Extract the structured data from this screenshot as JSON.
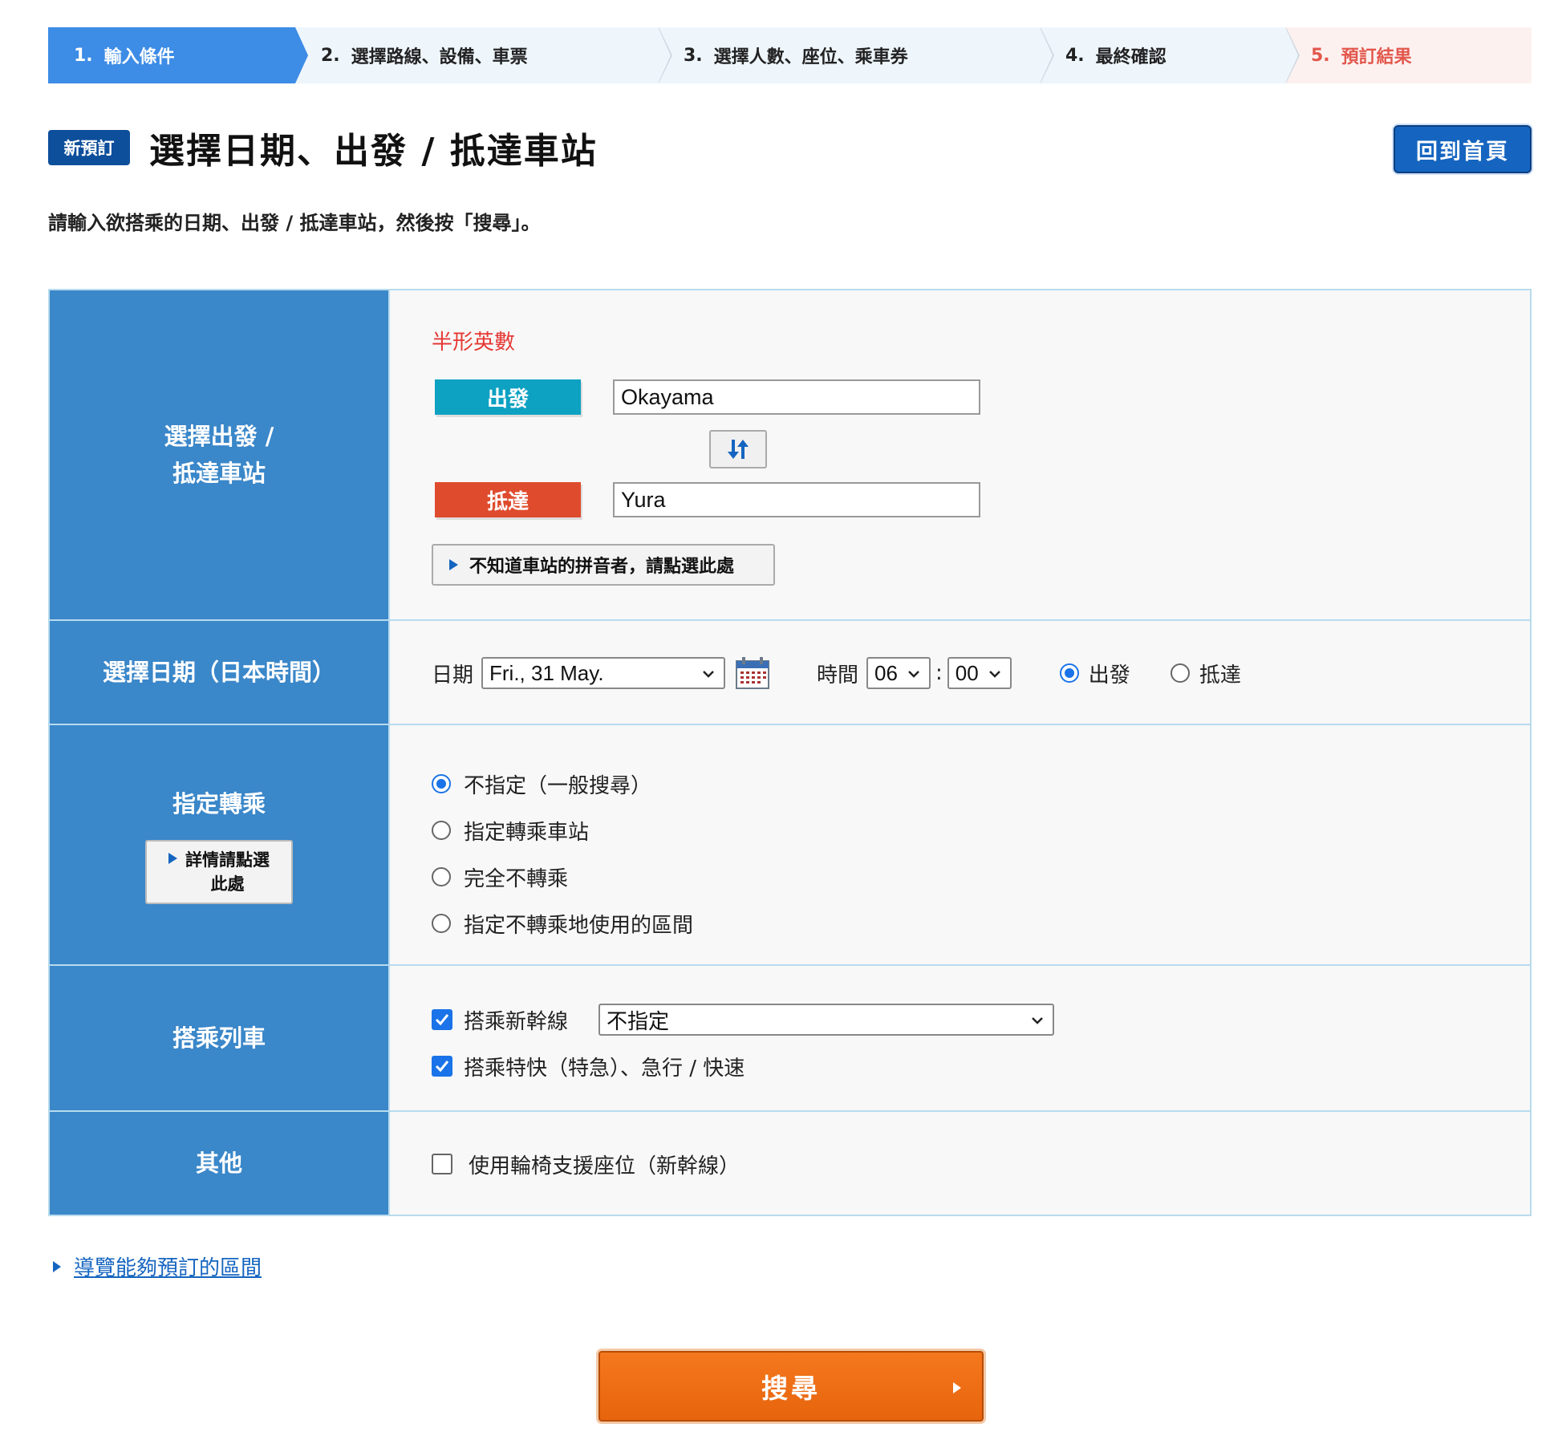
{
  "steps": [
    {
      "num": "1.",
      "label": "輸入條件"
    },
    {
      "num": "2.",
      "label": "選擇路線、設備、車票"
    },
    {
      "num": "3.",
      "label": "選擇人數、座位、乘車券"
    },
    {
      "num": "4.",
      "label": "最終確認"
    },
    {
      "num": "5.",
      "label": "預訂結果"
    }
  ],
  "header": {
    "badge": "新預訂",
    "title": "選擇日期、出發 / 抵達車站",
    "home_button": "回到首頁"
  },
  "intro": "請輸入欲搭乘的日期、出發 / 抵達車站，然後按「搜尋」。",
  "stations": {
    "label_line1": "選擇出發 /",
    "label_line2": "抵達車站",
    "hint": "半形英數",
    "departure_tag": "出發",
    "departure_value": "Okayama",
    "arrival_tag": "抵達",
    "arrival_value": "Yura",
    "pinyin_button": "不知道車站的拼音者，請點選此處"
  },
  "date": {
    "label": "選擇日期（日本時間）",
    "date_label": "日期",
    "date_value": "Fri., 31 May.",
    "time_label": "時間",
    "hour": "06",
    "colon": ":",
    "minute": "00",
    "opt_depart": "出發",
    "opt_arrive": "抵達",
    "selected": "出發"
  },
  "transfer": {
    "label": "指定轉乘",
    "detail_line1": "詳情請點選",
    "detail_line2": "此處",
    "options": [
      "不指定（一般搜尋）",
      "指定轉乘車站",
      "完全不轉乘",
      "指定不轉乘地使用的區間"
    ],
    "selected_index": 0
  },
  "trains": {
    "label": "搭乘列車",
    "shinkansen": "搭乘新幹線",
    "shinkansen_checked": true,
    "shinkansen_select": "不指定",
    "express": "搭乘特快（特急）、急行 / 快速",
    "express_checked": true
  },
  "other": {
    "label": "其他",
    "wheelchair": "使用輪椅支援座位（新幹線）",
    "wheelchair_checked": false
  },
  "guide_link": "導覽能夠預訂的區間",
  "search_button": "搜尋",
  "colors": {
    "step_active": "#3d8ce6",
    "step_result": "#e2574c",
    "label_bg": "#3a87c9",
    "departure": "#0da1c2",
    "arrival": "#df4b2d",
    "search": "#f06c14",
    "link": "#1565c0"
  }
}
